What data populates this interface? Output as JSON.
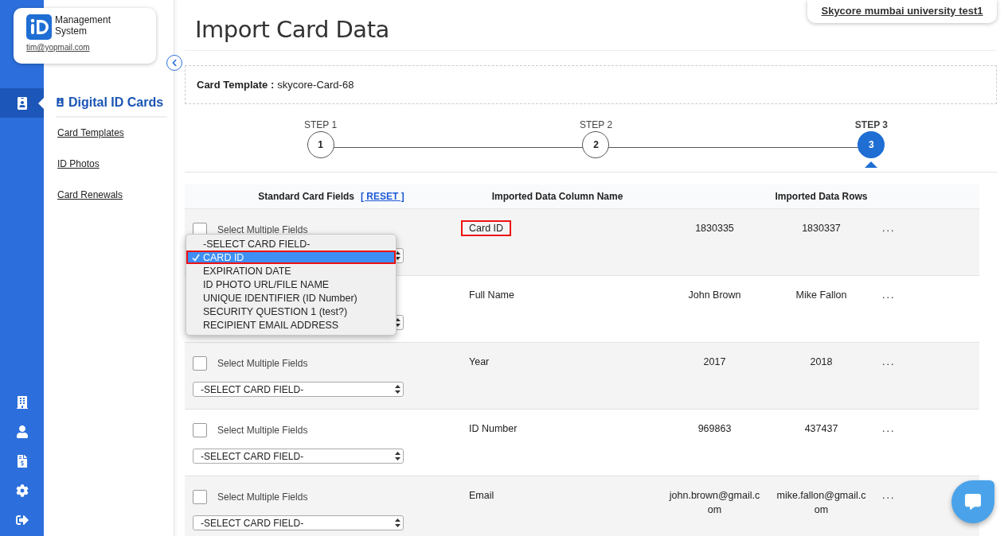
{
  "brand": {
    "name": "Management System",
    "email": "tim@yopmail.com"
  },
  "rail_items": [
    {
      "kind": "cards",
      "selected": true
    },
    {
      "kind": "building",
      "selected": false
    },
    {
      "kind": "user",
      "selected": false
    },
    {
      "kind": "invoice",
      "selected": false
    },
    {
      "kind": "settings",
      "selected": false
    },
    {
      "kind": "logout",
      "selected": false
    }
  ],
  "sidebar": {
    "title": "Digital ID Cards",
    "items": [
      "Card Templates",
      "ID Photos",
      "Card Renewals"
    ]
  },
  "account": "Skycore mumbai university test1",
  "page_title": "Import Card Data",
  "template": {
    "label": "Card Template :",
    "value": "skycore-Card-68"
  },
  "steps": [
    {
      "label": "STEP 1",
      "number": "1",
      "selected": false
    },
    {
      "label": "STEP 2",
      "number": "2",
      "selected": false
    },
    {
      "label": "STEP 3",
      "number": "3",
      "selected": true
    }
  ],
  "table": {
    "columns": [
      "Standard Card Fields",
      "Imported Data Column Name",
      "Imported Data Rows"
    ],
    "reset": "[ RESET ]",
    "rows": [
      {
        "checked": false,
        "multi_label": "Select Multiple Fields",
        "column_name": "Card ID",
        "highlighted": true,
        "values": [
          "1830335",
          "1830337"
        ],
        "more": "..."
      },
      {
        "column_name": "Full Name",
        "highlighted": false,
        "values": [
          "John Brown",
          "Mike Fallon"
        ],
        "more": "..."
      },
      {
        "checked": false,
        "multi_label": "Select Multiple Fields",
        "select_value": "-SELECT CARD FIELD-",
        "column_name": "Year",
        "highlighted": false,
        "values": [
          "2017",
          "2018"
        ],
        "more": "..."
      },
      {
        "checked": false,
        "multi_label": "Select Multiple Fields",
        "select_value": "-SELECT CARD FIELD-",
        "column_name": "ID Number",
        "highlighted": false,
        "values": [
          "969863",
          "437437"
        ],
        "more": "..."
      },
      {
        "checked": false,
        "multi_label": "Select Multiple Fields",
        "select_value": "-SELECT CARD FIELD-",
        "column_name": "Email",
        "highlighted": false,
        "values": [
          "john.brown@gmail.com",
          "mike.fallon@gmail.com"
        ],
        "more": "..."
      }
    ]
  },
  "dropdown": {
    "options": [
      {
        "label": "-SELECT CARD FIELD-",
        "selected": false,
        "highlighted": false
      },
      {
        "label": "CARD ID",
        "selected": true,
        "highlighted": true
      },
      {
        "label": "EXPIRATION DATE",
        "selected": false,
        "highlighted": false
      },
      {
        "label": "ID PHOTO URL/FILE NAME",
        "selected": false,
        "highlighted": false
      },
      {
        "label": "UNIQUE IDENTIFIER (ID Number)",
        "selected": false,
        "highlighted": false
      },
      {
        "label": "SECURITY QUESTION 1 (test?)",
        "selected": false,
        "highlighted": false
      },
      {
        "label": "RECIPIENT EMAIL ADDRESS",
        "selected": false,
        "highlighted": false
      }
    ]
  }
}
